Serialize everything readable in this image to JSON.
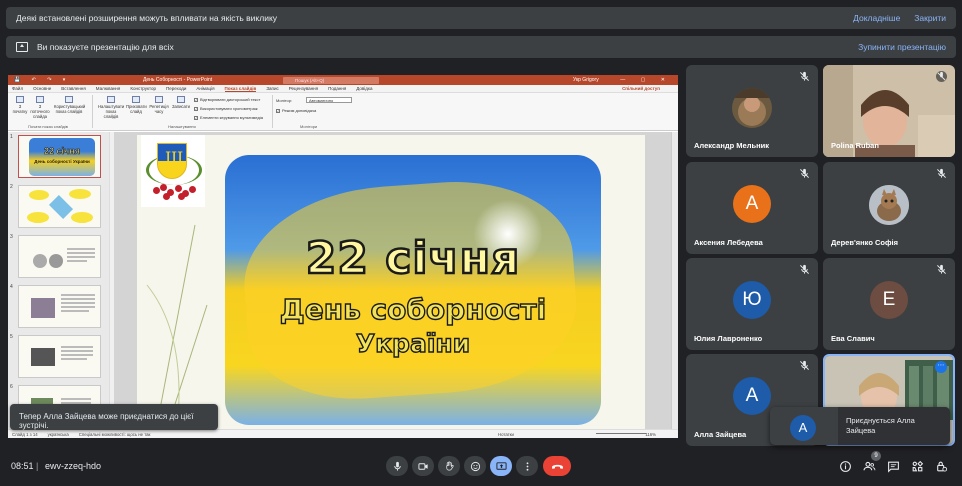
{
  "banners": {
    "extensions": {
      "message": "Деякі встановлені розширення можуть впливати на якість виклику",
      "details_label": "Докладніше",
      "close_label": "Закрити"
    },
    "presenting": {
      "message": "Ви показуєте презентацію для всіх",
      "stop_label": "Зупинити презентацію"
    }
  },
  "shared_screen": {
    "window_title": "День Соборності - PowerPoint",
    "search_placeholder": "Пошук (Alt+Q)",
    "user_name": "Укр Grigory",
    "window_controls": "— ▢ ✕",
    "quick_access": "💾 ↶ ↷ ▾",
    "tabs": [
      "Файл",
      "Основне",
      "Вставлення",
      "Малювання",
      "Конструктор",
      "Переходи",
      "Анімація",
      "Показ слайдів",
      "Запис",
      "Рецензування",
      "Подання",
      "Довідка"
    ],
    "active_tab": "Показ слайдів",
    "share_label": "Спільний доступ",
    "ribbon": {
      "btn1": "З початку",
      "btn2": "З поточного слайда",
      "btn3": "Користувацький показ слайдів",
      "btn4": "Налаштувати показ слайдів",
      "btn5": "Приховати слайд",
      "btn6": "Репетиція часу",
      "btn7": "Записати",
      "group1": "Почати показ слайдів",
      "group2": "Налаштування",
      "group3": "Монітори",
      "chk1": "Відтворювати дикторський текст",
      "chk2": "Використовувати хронометраж",
      "chk3": "Елементи керування мультимедіа",
      "monitor_label": "Монітор:",
      "monitor_value": "Автоматично",
      "presenter_view": "Режим доповідача"
    },
    "slide_numbers": [
      "1",
      "2",
      "3",
      "4",
      "5",
      "6"
    ],
    "slide": {
      "line1": "22 січня",
      "line2": "День соборності",
      "line3": "України"
    },
    "thumb1": {
      "line1": "22 січня",
      "line2": "День соборності України"
    },
    "status": {
      "slide_info": "Слайд 1 з 14",
      "language": "українська",
      "accessibility": "Спеціальні можливості: щось не так",
      "notes": "Нотатки",
      "zoom": "116%"
    }
  },
  "toast": {
    "message": "Тепер Алла Зайцева може приєднатися до цієї зустрічі."
  },
  "participants": [
    {
      "name": "Александр Мельник",
      "muted": true,
      "type": "photo"
    },
    {
      "name": "Polina Ruban",
      "muted": true,
      "type": "camera"
    },
    {
      "name": "Аксения Лебедева",
      "muted": true,
      "type": "initial",
      "initial": "А",
      "color": "#e8711a"
    },
    {
      "name": "Дерев'янко Софія",
      "muted": true,
      "type": "photo"
    },
    {
      "name": "Юлия Лавроненко",
      "muted": true,
      "type": "initial",
      "initial": "Ю",
      "color": "#1e5ba8"
    },
    {
      "name": "Ева Славич",
      "muted": true,
      "type": "initial",
      "initial": "Е",
      "color": "#6d4c41"
    },
    {
      "name": "Алла Зайцева",
      "muted": true,
      "type": "initial",
      "initial": "А",
      "color": "#1e5ba8"
    },
    {
      "name": "",
      "muted": false,
      "type": "camera"
    }
  ],
  "join_popup": {
    "initial": "А",
    "line1": "Приєднується Алла",
    "line2": "Зайцева"
  },
  "bottom_bar": {
    "time": "08:51",
    "separator": "|",
    "meeting_code": "ewv-zzeq-hdo",
    "people_count": "9"
  },
  "colors": {
    "accent": "#8ab4f8",
    "end_call": "#ea4335",
    "present_active": "#8ab4f8",
    "background": "#202124"
  },
  "icons": [
    "mic-icon",
    "camera-icon",
    "hand-icon",
    "emoji-icon",
    "present-icon",
    "more-icon",
    "end-call-icon",
    "info-icon",
    "people-icon",
    "chat-icon",
    "activities-icon",
    "lock-icon",
    "mic-off-icon"
  ]
}
